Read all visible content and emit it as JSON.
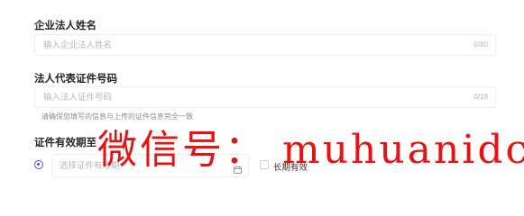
{
  "form": {
    "legal_name": {
      "label": "企业法人姓名",
      "placeholder": "输入企业法人姓名",
      "counter": "0/80"
    },
    "id_number": {
      "label": "法人代表证件号码",
      "placeholder": "输入法人证件号码",
      "counter": "0/18",
      "hint": "请确保您填写的信息与上传的证件信息完全一致"
    },
    "validity": {
      "label": "证件有效期至",
      "date_placeholder": "选择证件有效期",
      "long_term_label": "长期有效"
    }
  },
  "watermark": {
    "text": "微信号：  muhuanidc"
  },
  "colors": {
    "accent": "#4c4cf0",
    "watermark": "#e30000"
  },
  "icons": {
    "calendar": "calendar-icon"
  }
}
